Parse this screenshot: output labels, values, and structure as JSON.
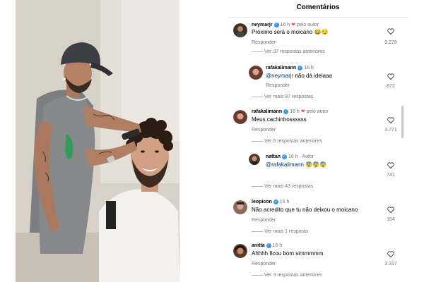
{
  "panel": {
    "title": "Comentários"
  },
  "labels": {
    "reply": "Responder",
    "by_author": "pelo autor",
    "author": "Autor"
  },
  "comments": [
    {
      "user": "neymarjr",
      "time": "16 h",
      "liked_by_author": true,
      "text": "Próximo será o moicano 😂😏",
      "likes": "9.279",
      "more": "Ver 37 respostas anteriores",
      "avatar_color": "#3a3026"
    },
    {
      "user": "rafakalimann",
      "time": "16 h",
      "mention": "@neymarjr",
      "text": "não dá ideiaaa",
      "likes": "872",
      "more": "Ver mais 97 respostas",
      "avatar_color": "#6b3b34"
    },
    {
      "user": "rafakalimann",
      "time": "16 h",
      "liked_by_author": true,
      "text": "Meus cachinhossssss",
      "likes": "3.771",
      "more": "Ver 5 respostas anteriores",
      "avatar_color": "#6b3b34"
    },
    {
      "user": "nattan",
      "time": "16 h",
      "tag": "Autor",
      "mention": "@rafakalimann",
      "text": "😨😨😨",
      "likes": "741",
      "more": "Ver mais 43 respostas",
      "avatar_color": "#4a3a2e"
    },
    {
      "user": "leopicon",
      "time": "15 h",
      "text": "Não acredito que tu não deixou o moicano",
      "likes": "154",
      "more": "Ver mais 1 resposta",
      "avatar_color": "#8a6a5a"
    },
    {
      "user": "anitta",
      "time": "16 h",
      "text": "Ahhhh ficou bom simmmmm",
      "likes": "3.317",
      "more": "Ver 3 respostas anteriores",
      "avatar_color": "#5a3a28"
    }
  ]
}
